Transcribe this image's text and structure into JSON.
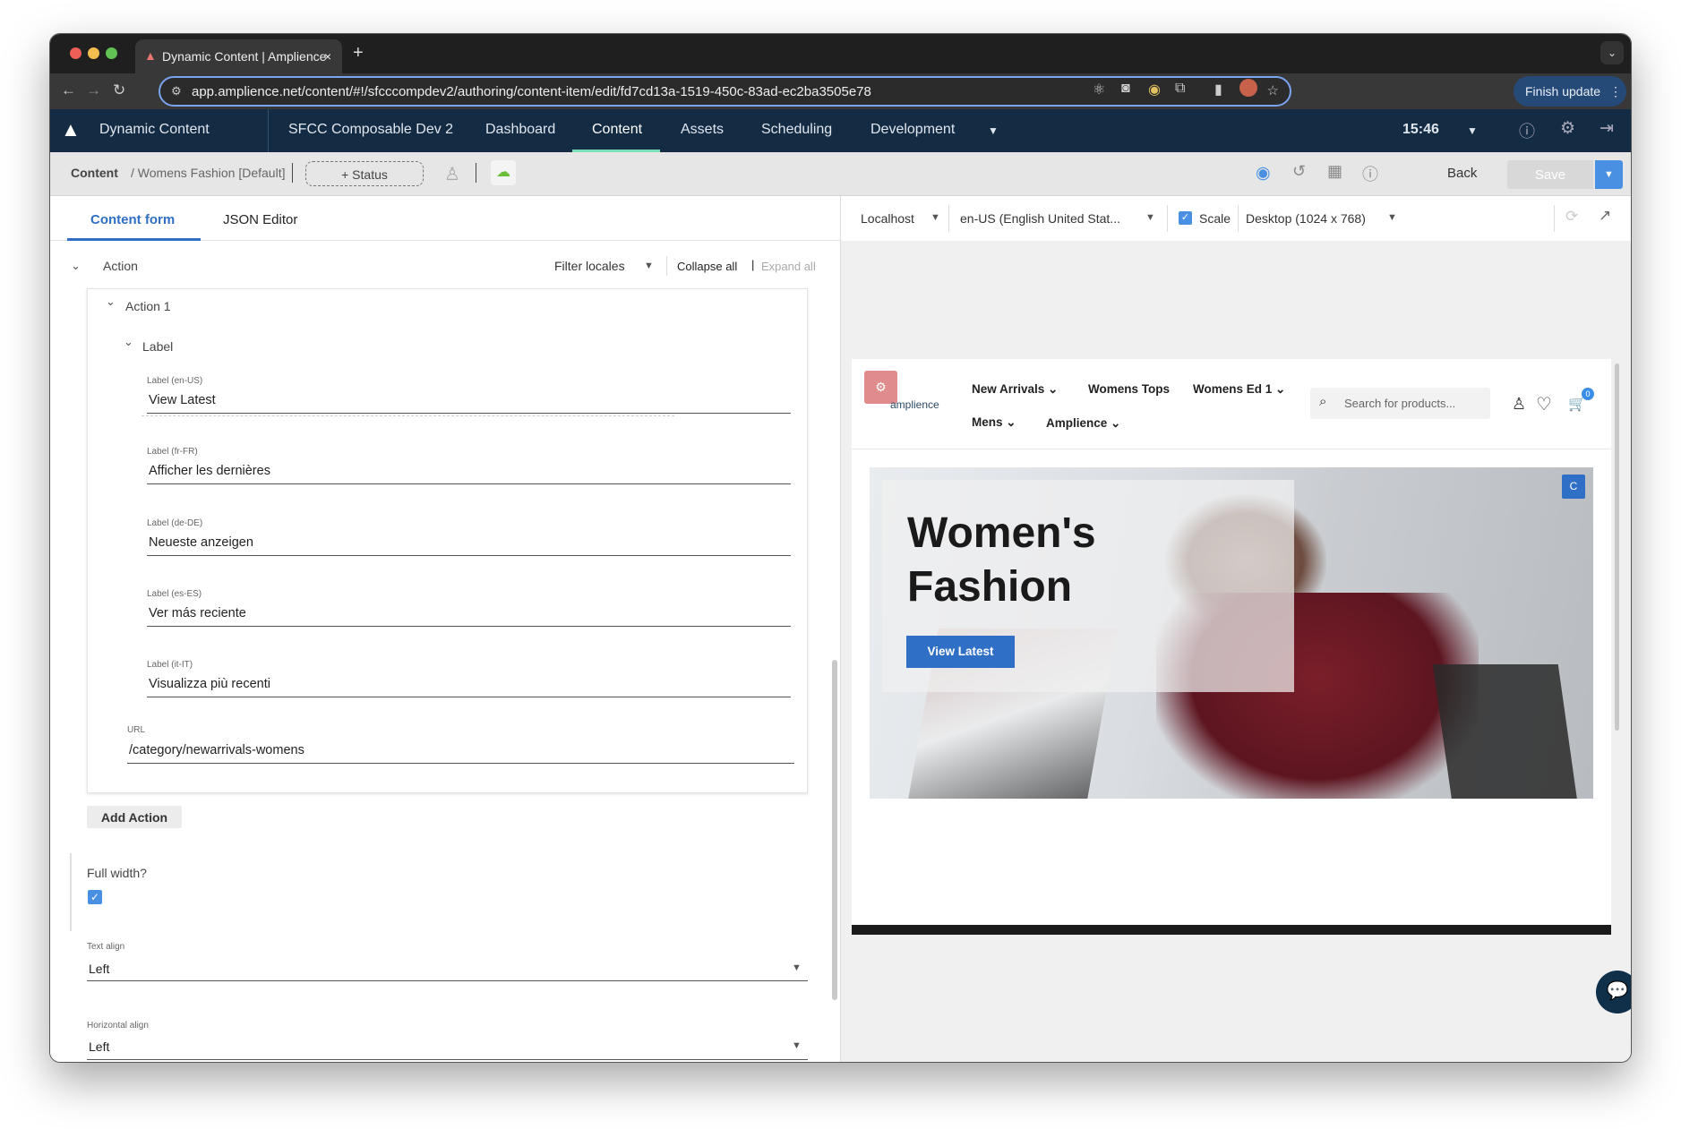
{
  "browser": {
    "tab_title": "Dynamic Content | Amplience",
    "url": "app.amplience.net/content/#!/sfcccompdev2/authoring/content-item/edit/fd7cd13a-1519-450c-83ad-ec2ba3505e78",
    "finish_update": "Finish update"
  },
  "nav": {
    "app_name": "Dynamic Content",
    "hub": "SFCC Composable Dev 2",
    "items": [
      "Dashboard",
      "Content",
      "Assets",
      "Scheduling",
      "Development"
    ],
    "active": "Content",
    "time": "15:46"
  },
  "toolbar": {
    "breadcrumb_root": "Content",
    "breadcrumb_item": "/ Womens Fashion [Default]",
    "status_button": "+ Status",
    "back": "Back",
    "save": "Save"
  },
  "form": {
    "tabs": [
      "Content form",
      "JSON Editor"
    ],
    "section": "Action",
    "filter_locales": "Filter locales",
    "collapse_all": "Collapse all",
    "expand_all": "Expand all",
    "action_title": "Action 1",
    "label_group": "Label",
    "fields": [
      {
        "label": "Label (en-US)",
        "value": "View Latest"
      },
      {
        "label": "Label (fr-FR)",
        "value": "Afficher les dernières"
      },
      {
        "label": "Label (de-DE)",
        "value": "Neueste anzeigen"
      },
      {
        "label": "Label (es-ES)",
        "value": "Ver más reciente"
      },
      {
        "label": "Label (it-IT)",
        "value": "Visualizza più recenti"
      }
    ],
    "url_label": "URL",
    "url_value": "/category/newarrivals-womens",
    "add_action": "Add Action",
    "full_width_label": "Full width?",
    "full_width_checked": true,
    "text_align_label": "Text align",
    "text_align_value": "Left",
    "horizontal_align_label": "Horizontal align",
    "horizontal_align_value": "Left"
  },
  "preview": {
    "environment": "Localhost",
    "locale": "en-US (English United Stat...",
    "scale_label": "Scale",
    "scale_checked": true,
    "device": "Desktop (1024 x 768)",
    "site": {
      "logo_text": "amplience",
      "nav": [
        "New Arrivals",
        "Womens Tops",
        "Womens Ed 1",
        "Mens",
        "Amplience"
      ],
      "search_placeholder": "Search for products...",
      "cart_count": "0",
      "hero_title_1": "Women's",
      "hero_title_2": "Fashion",
      "hero_button": "View Latest",
      "badge": "C"
    }
  },
  "colors": {
    "nav_bg": "#142b44",
    "accent": "#2f6fc6",
    "active_underline": "#7ee0b8"
  }
}
